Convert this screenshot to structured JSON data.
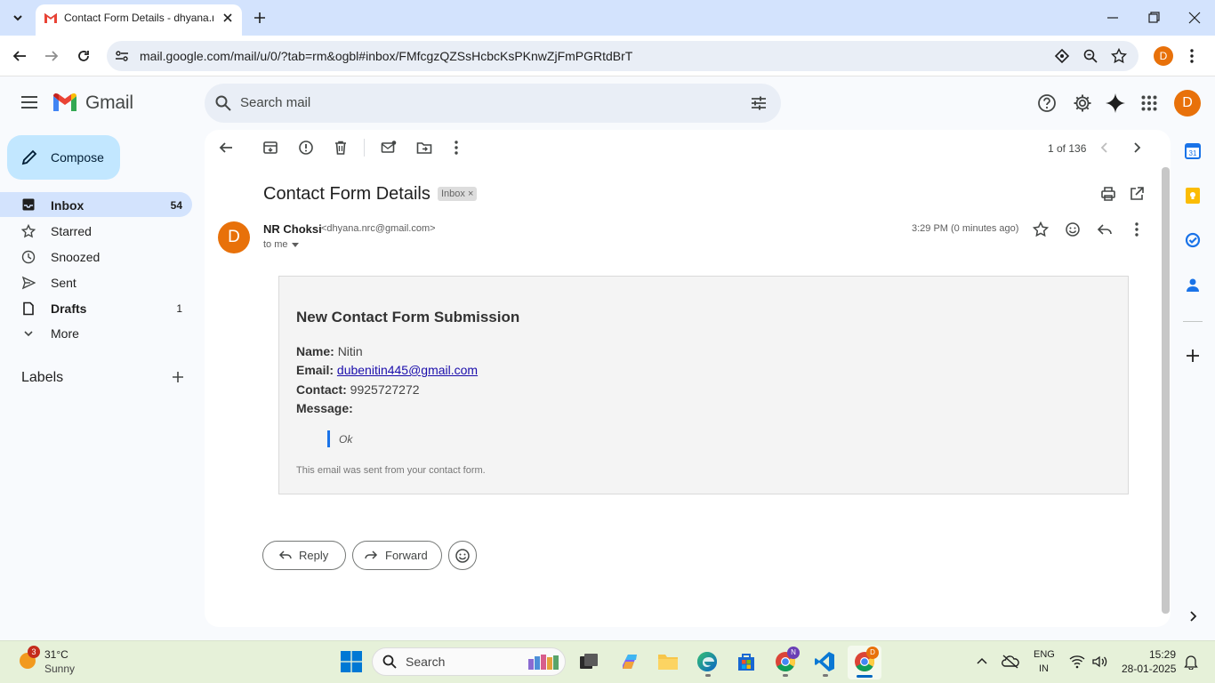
{
  "browser": {
    "tab_title": "Contact Form Details - dhyana.nrc@gmail.com",
    "url": "mail.google.com/mail/u/0/?tab=rm&ogbl#inbox/FMfcgzQZSsHcbcKsPKnwZjFmPGRtdBrT",
    "profile_initial": "D"
  },
  "gmail": {
    "brand": "Gmail",
    "search_placeholder": "Search mail",
    "avatar_initial": "D",
    "compose_label": "Compose",
    "nav": [
      {
        "label": "Inbox",
        "count": "54"
      },
      {
        "label": "Starred",
        "count": ""
      },
      {
        "label": "Snoozed",
        "count": ""
      },
      {
        "label": "Sent",
        "count": ""
      },
      {
        "label": "Drafts",
        "count": "1"
      },
      {
        "label": "More",
        "count": ""
      }
    ],
    "labels_title": "Labels"
  },
  "toolbar": {
    "pager": "1 of 136"
  },
  "email": {
    "subject": "Contact Form Details",
    "chip": "Inbox",
    "chip_close": "×",
    "sender_initial": "D",
    "sender_name": "NR Choksi",
    "sender_email": "<dhyana.nrc@gmail.com>",
    "to": "to me",
    "time": "3:29 PM (0 minutes ago)",
    "body": {
      "title": "New Contact Form Submission",
      "name_label": "Name:",
      "name_value": "Nitin",
      "email_label": "Email:",
      "email_value": "dubenitin445@gmail.com",
      "contact_label": "Contact:",
      "contact_value": "9925727272",
      "message_label": "Message:",
      "message_value": "Ok",
      "footer": "This email was sent from your contact form."
    },
    "reply_label": "Reply",
    "forward_label": "Forward"
  },
  "taskbar": {
    "weather_badge": "3",
    "temperature": "31°C",
    "condition": "Sunny",
    "search_label": "Search",
    "lang_top": "ENG",
    "lang_bottom": "IN",
    "time": "15:29",
    "date": "28-01-2025",
    "chrome_badge": "N",
    "chrome2_badge": "D"
  },
  "colors": {
    "accent": "#0b57d0",
    "avatar": "#e8710a",
    "nav_active": "#d3e3fd",
    "compose": "#c2e7ff"
  }
}
